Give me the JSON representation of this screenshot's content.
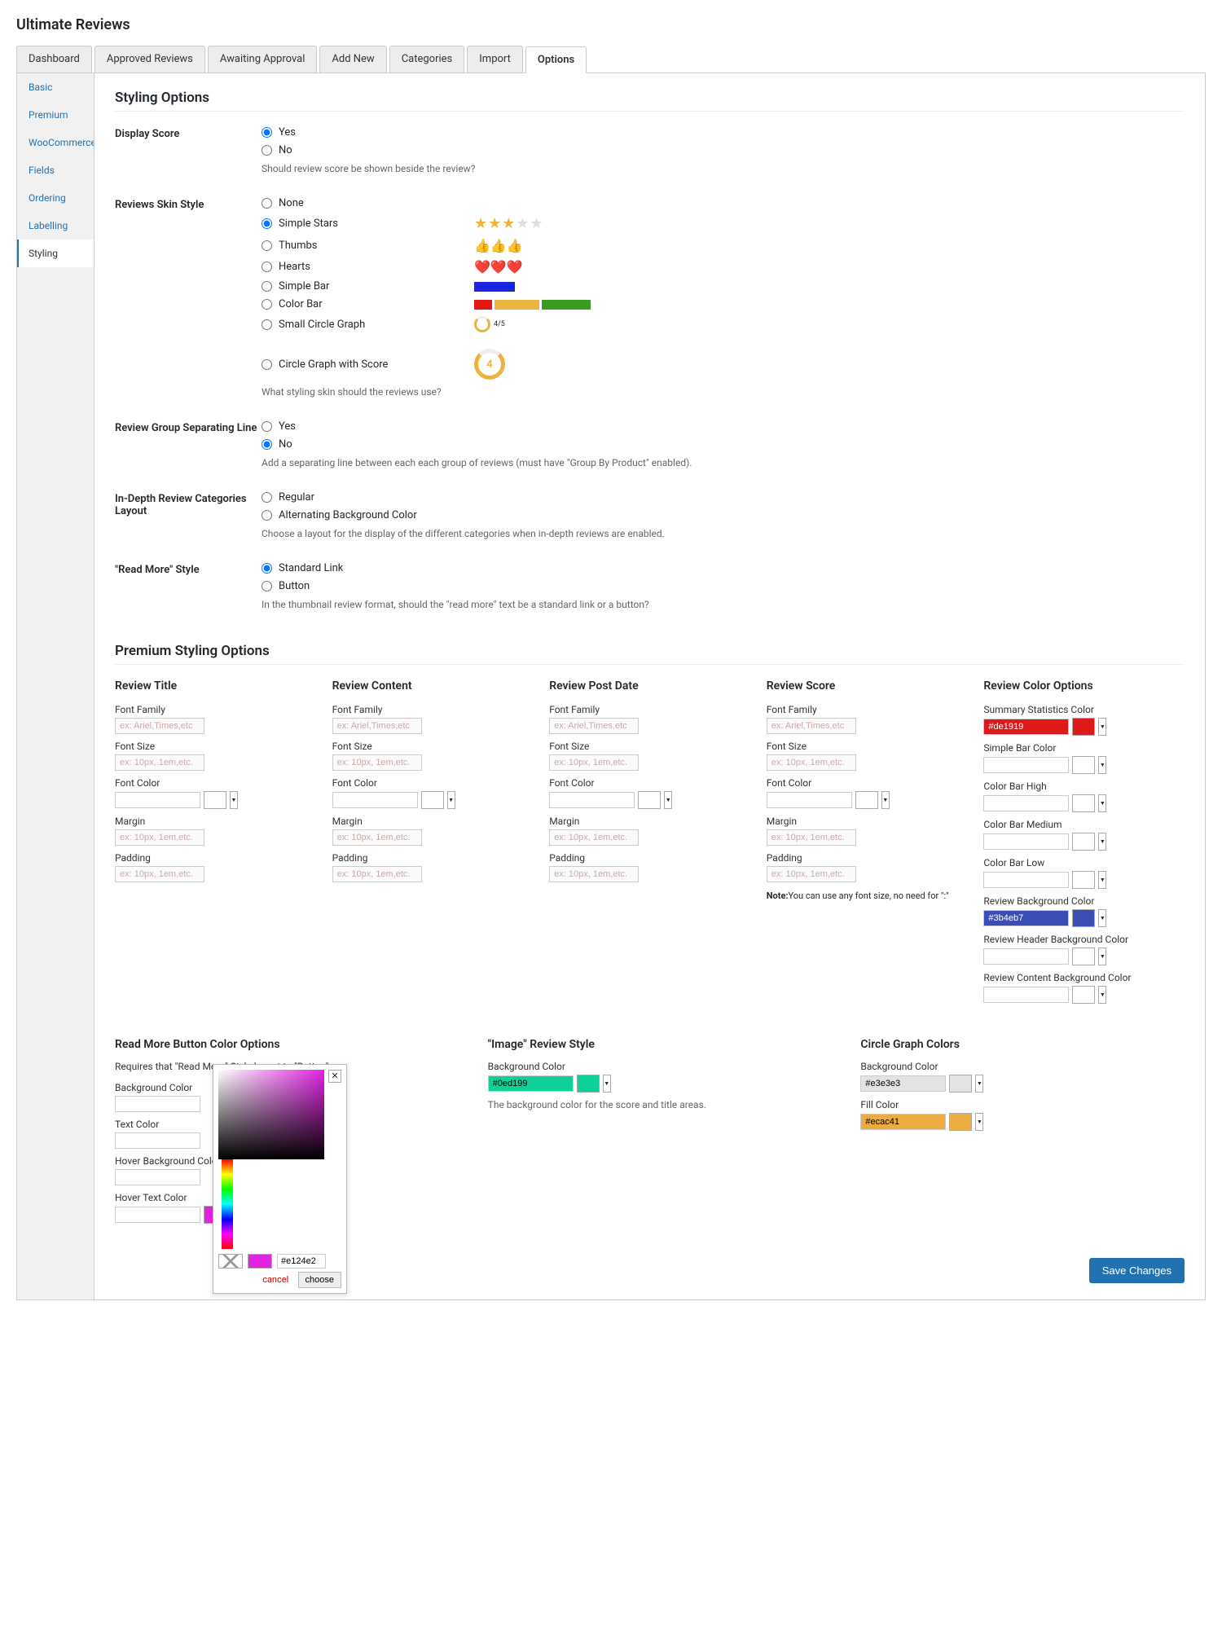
{
  "page_title": "Ultimate Reviews",
  "tabs": [
    {
      "label": "Dashboard"
    },
    {
      "label": "Approved Reviews"
    },
    {
      "label": "Awaiting Approval"
    },
    {
      "label": "Add New"
    },
    {
      "label": "Categories"
    },
    {
      "label": "Import"
    },
    {
      "label": "Options",
      "active": true
    }
  ],
  "sidebar": [
    {
      "label": "Basic"
    },
    {
      "label": "Premium"
    },
    {
      "label": "WooCommerce"
    },
    {
      "label": "Fields"
    },
    {
      "label": "Ordering"
    },
    {
      "label": "Labelling"
    },
    {
      "label": "Styling",
      "active": true
    }
  ],
  "section1_title": "Styling Options",
  "display_score": {
    "label": "Display Score",
    "opts": [
      "Yes",
      "No"
    ],
    "selected": "Yes",
    "help": "Should review score be shown beside the review?"
  },
  "skin": {
    "label": "Reviews Skin Style",
    "opts": [
      "None",
      "Simple Stars",
      "Thumbs",
      "Hearts",
      "Simple Bar",
      "Color Bar",
      "Small Circle Graph",
      "Circle Graph with Score"
    ],
    "selected": "Simple Stars",
    "circle_val": "4",
    "circle_sm_txt": "4/5",
    "help": "What styling skin should the reviews use?"
  },
  "sep_line": {
    "label": "Review Group Separating Line",
    "opts": [
      "Yes",
      "No"
    ],
    "selected": "No",
    "help": "Add a separating line between each each group of reviews (must have \"Group By Product\" enabled)."
  },
  "layout": {
    "label": "In-Depth Review Categories Layout",
    "opts": [
      "Regular",
      "Alternating Background Color"
    ],
    "help": "Choose a layout for the display of the different categories when in-depth reviews are enabled."
  },
  "readmore": {
    "label": "\"Read More\" Style",
    "opts": [
      "Standard Link",
      "Button"
    ],
    "selected": "Standard Link",
    "help": "In the thumbnail review format, should the \"read more\" text be a standard link or a button?"
  },
  "premium_title": "Premium Styling Options",
  "style_cols": {
    "title": {
      "h": "Review Title"
    },
    "content": {
      "h": "Review Content"
    },
    "postdate": {
      "h": "Review Post Date"
    },
    "score": {
      "h": "Review Score"
    },
    "labels": {
      "ff": "Font Family",
      "fs": "Font Size",
      "fc": "Font Color",
      "m": "Margin",
      "p": "Padding"
    },
    "ph_ff": "ex: Ariel,Times,etc",
    "ph_px": "ex: 10px, 1em,etc.",
    "note_label": "Note:",
    "note_text": "You can use any font size, no need for \":\""
  },
  "color_opts": {
    "h": "Review Color Options",
    "items": [
      {
        "label": "Summary Statistics Color",
        "value": "#de1919",
        "color": "#de1919"
      },
      {
        "label": "Simple Bar Color",
        "value": "",
        "color": ""
      },
      {
        "label": "Color Bar High",
        "value": "",
        "color": ""
      },
      {
        "label": "Color Bar Medium",
        "value": "",
        "color": ""
      },
      {
        "label": "Color Bar Low",
        "value": "",
        "color": ""
      },
      {
        "label": "Review Background Color",
        "value": "#3b4eb7",
        "color": "#3b4eb7"
      },
      {
        "label": "Review Header Background Color",
        "value": "",
        "color": ""
      },
      {
        "label": "Review Content Background Color",
        "value": "",
        "color": ""
      }
    ]
  },
  "readmore_colors": {
    "h": "Read More Button Color Options",
    "desc": "Requires that \"Read More\" Style be set to \"Button\"",
    "items": [
      {
        "label": "Background Color",
        "value": "",
        "color": ""
      },
      {
        "label": "Text Color",
        "value": "",
        "color": ""
      },
      {
        "label": "Hover Background Color",
        "value": "",
        "color": ""
      },
      {
        "label": "Hover Text Color",
        "value": "",
        "color": "#e124e2"
      }
    ]
  },
  "image_style": {
    "h": "\"Image\" Review Style",
    "items": [
      {
        "label": "Background Color",
        "value": "#0ed199",
        "color": "#0ed199"
      }
    ],
    "help": "The background color for the score and title areas."
  },
  "circle_colors": {
    "h": "Circle Graph Colors",
    "items": [
      {
        "label": "Background Color",
        "value": "#e3e3e3",
        "color": "#e3e3e3"
      },
      {
        "label": "Fill Color",
        "value": "#ecac41",
        "color": "#ecac41"
      }
    ]
  },
  "picker": {
    "hex": "#e124e2",
    "cancel": "cancel",
    "choose": "choose"
  },
  "save": "Save Changes"
}
